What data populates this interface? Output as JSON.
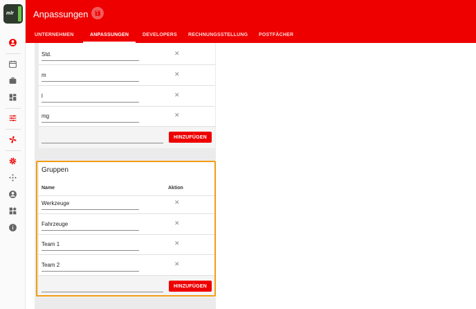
{
  "app": {
    "logo_text": "mlr",
    "page_title": "Anpassungen"
  },
  "tabs": [
    {
      "label": "UNTERNEHMEN",
      "active": false
    },
    {
      "label": "ANPASSUNGEN",
      "active": true
    },
    {
      "label": "DEVELOPERS",
      "active": false
    },
    {
      "label": "RECHNUNGSSTELLUNG",
      "active": false
    },
    {
      "label": "POSTFÄCHER",
      "active": false
    }
  ],
  "sidebar": {
    "icons": [
      "user-icon",
      "calendar-icon",
      "briefcase-icon",
      "dashboard-icon",
      "sliders-icon",
      "fan-icon",
      "gear-icon",
      "move-icon",
      "account-icon",
      "widgets-icon",
      "info-icon"
    ]
  },
  "units": {
    "rows": [
      "Std.",
      "m",
      "l",
      "mg"
    ],
    "add_label": "HINZUFÜGEN"
  },
  "groups": {
    "title": "Gruppen",
    "col_name": "Name",
    "col_action": "Aktion",
    "rows": [
      "Werkzeuge",
      "Fahrzeuge",
      "Team 1",
      "Team 2"
    ],
    "add_label": "HINZUFÜGEN"
  },
  "colors": {
    "brand": "#ee0000",
    "highlight": "#f39c12"
  }
}
